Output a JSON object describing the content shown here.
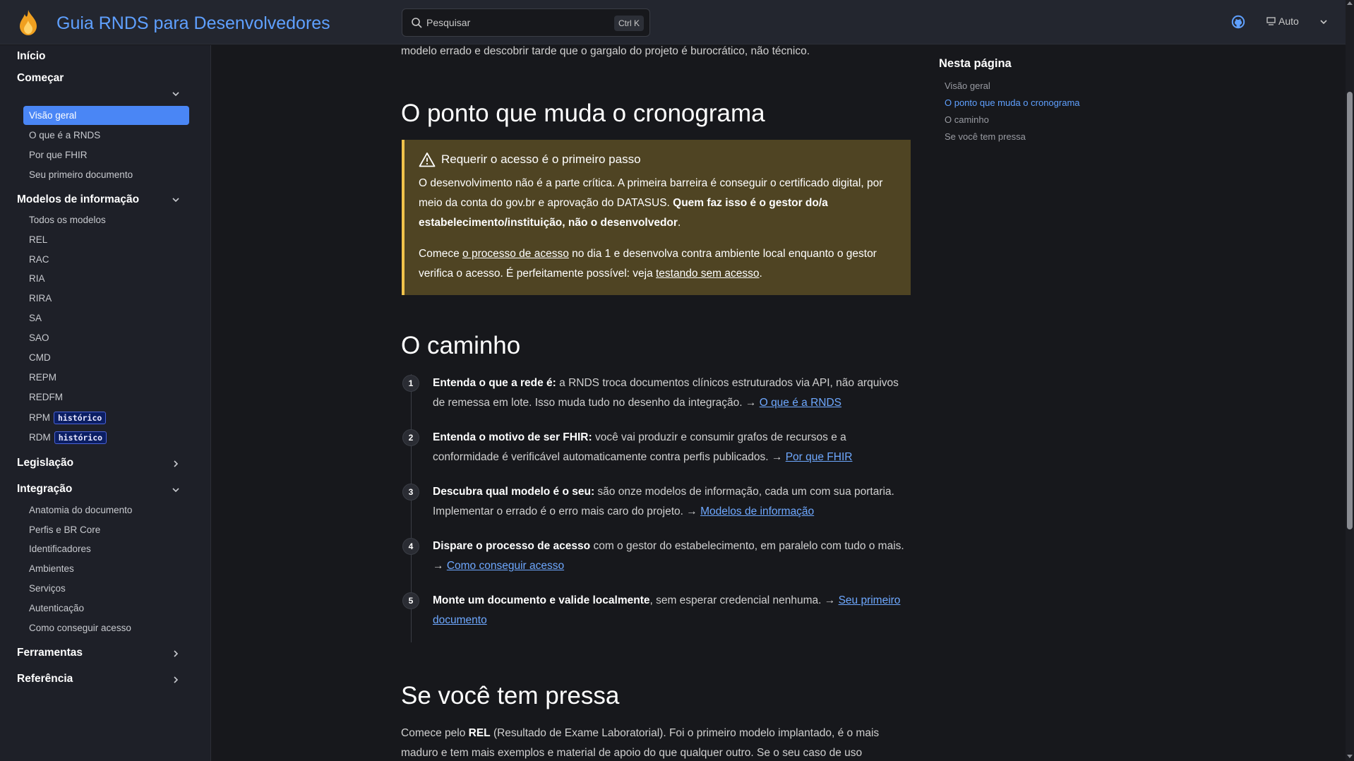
{
  "header": {
    "site_title": "Guia RNDS para Desenvolvedores",
    "search_placeholder": "Pesquisar",
    "search_shortcut": "Ctrl K",
    "theme_label": "Auto",
    "brand_color": "#5fa0ff",
    "logo_icon": "flame-icon",
    "repo_icon": "github-icon"
  },
  "sidebar": {
    "home": "Início",
    "sections": [
      {
        "label": "Começar",
        "expanded": true,
        "items": [
          "Visão geral",
          "O que é a RNDS",
          "Por que FHIR",
          "Seu primeiro documento"
        ],
        "active": "Visão geral"
      },
      {
        "label": "Modelos de informação",
        "expanded": true,
        "items": [
          "Todos os modelos",
          "REL",
          "RAC",
          "RIA",
          "RIRA",
          "SA",
          "SAO",
          "CMD",
          "REPM",
          "REDFM",
          "RPM",
          "RDM"
        ],
        "badges": {
          "RPM": "histórico",
          "RDM": "histórico"
        }
      },
      {
        "label": "Legislação",
        "expanded": false
      },
      {
        "label": "Integração",
        "expanded": true,
        "items": [
          "Anatomia do documento",
          "Perfis e BR Core",
          "Identificadores",
          "Ambientes",
          "Serviços",
          "Autenticação",
          "Como conseguir acesso"
        ]
      },
      {
        "label": "Ferramentas",
        "expanded": false
      },
      {
        "label": "Referência",
        "expanded": false
      }
    ]
  },
  "main": {
    "intro_tail": "modelo errado e descobrir tarde que o gargalo do projeto é burocrático, não técnico.",
    "h_cronograma": "O ponto que muda o cronograma",
    "callout": {
      "title": "Requerir o acesso é o primeiro passo",
      "p1_text": "O desenvolvimento não é a parte crítica. A primeira barreira é conseguir o certificado digital, por meio da conta do gov.br e aprovação do DATASUS. ",
      "p1_bold": "Quem faz isso é o gestor do/a estabelecimento/instituição, não o desenvolvedor",
      "p1_end": ".",
      "p2_a": "Comece ",
      "p2_link1": "o processo de acesso",
      "p2_b": " no dia 1 e desenvolva contra ambiente local enquanto o gestor verifica o acesso. É perfeitamente possível: veja ",
      "p2_link2": "testando sem acesso",
      "p2_end": "."
    },
    "h_caminho": "O caminho",
    "steps": [
      {
        "num": "1",
        "bold": "Entenda o que a rede é:",
        "text": " a RNDS troca documentos clínicos estruturados via API, não arquivos de remessa em lote. Isso muda tudo no desenho da integração. → ",
        "link": "O que é a RNDS"
      },
      {
        "num": "2",
        "bold": "Entenda o motivo de ser FHIR:",
        "text": " você vai produzir e consumir grafos de recursos e a conformidade é verificável automaticamente contra perfis publicados. → ",
        "link": "Por que FHIR"
      },
      {
        "num": "3",
        "bold": "Descubra qual modelo é o seu:",
        "text": " são onze modelos de informação, cada um com sua portaria. Implementar o errado é o erro mais caro do projeto. → ",
        "link": "Modelos de informação"
      },
      {
        "num": "4",
        "bold": "Dispare o processo de acesso",
        "text": " com o gestor do estabelecimento, em paralelo com tudo o mais. → ",
        "link": "Como conseguir acesso"
      },
      {
        "num": "5",
        "bold": "Monte um documento e valide localmente",
        "text": ", sem esperar credencial nenhuma. → ",
        "link": "Seu primeiro documento"
      }
    ],
    "h_pressa": "Se você tem pressa",
    "pressa_a": "Comece pelo ",
    "pressa_bold": "REL",
    "pressa_b": " (Resultado de Exame Laboratorial). Foi o primeiro modelo implantado, é o mais maduro e tem mais exemplos e material de apoio do que qualquer outro. Se o seu caso de uso"
  },
  "toc": {
    "title": "Nesta página",
    "items": [
      "Visão geral",
      "O ponto que muda o cronograma",
      "O caminho",
      "Se você tem pressa"
    ],
    "active": "O ponto que muda o cronograma"
  }
}
